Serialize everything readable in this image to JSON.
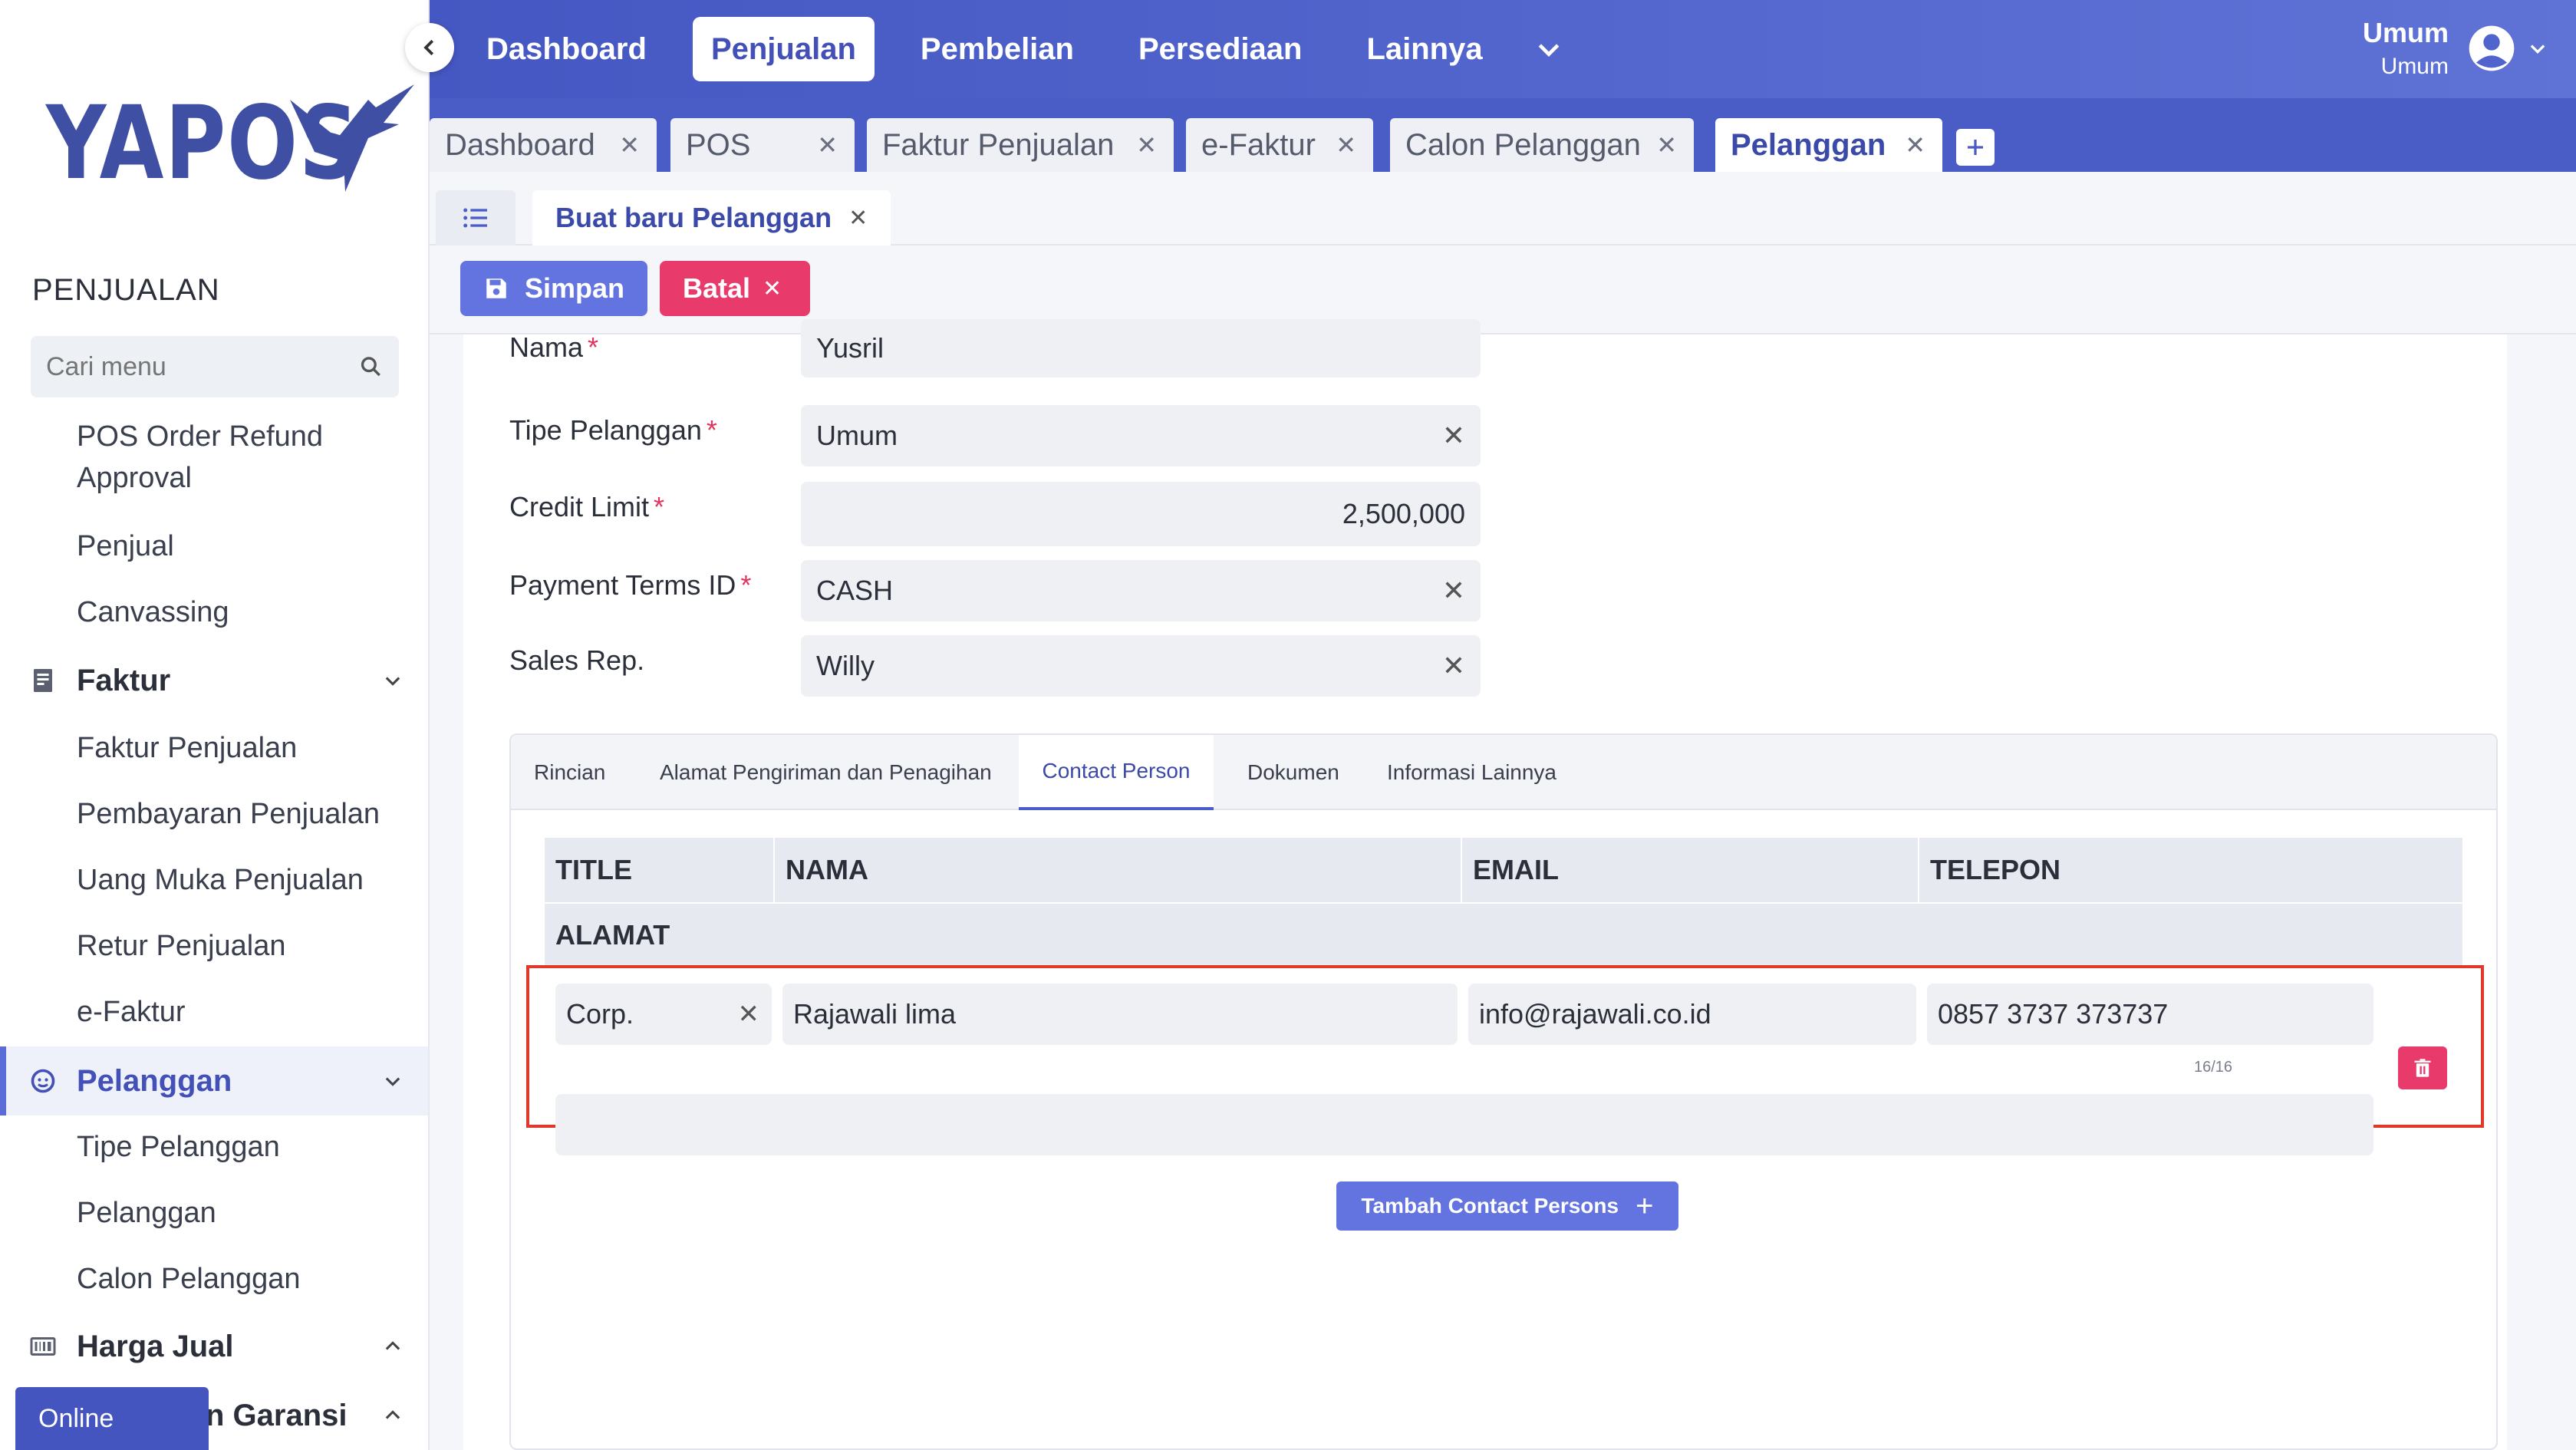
{
  "brand": {
    "logo_text": "YAPOS"
  },
  "sidebar": {
    "section_title": "PENJUALAN",
    "search_placeholder": "Cari menu",
    "items": [
      {
        "label": "POS Order Refund Approval",
        "type": "link"
      },
      {
        "label": "Penjual",
        "type": "link"
      },
      {
        "label": "Canvassing",
        "type": "link"
      }
    ],
    "group_faktur": {
      "label": "Faktur",
      "icon": "document-icon",
      "expanded": true
    },
    "faktur_items": [
      "Faktur Penjualan",
      "Pembayaran Penjualan",
      "Uang Muka Penjualan",
      "Retur Penjualan",
      "e-Faktur"
    ],
    "group_pelanggan": {
      "label": "Pelanggan",
      "icon": "smiley-icon",
      "expanded": true
    },
    "pelanggan_items": [
      "Tipe Pelanggan",
      "Pelanggan",
      "Calon Pelanggan"
    ],
    "group_harga": {
      "label": "Harga Jual",
      "icon": "barcode-icon",
      "expanded": false
    },
    "group_garansi": {
      "label": "n Garansi",
      "icon": "shield-icon",
      "expanded": false
    },
    "online_badge": "Online"
  },
  "topnav": {
    "items": [
      "Dashboard",
      "Penjualan",
      "Pembelian",
      "Persediaan",
      "Lainnya"
    ],
    "active": "Penjualan",
    "user_name": "Umum",
    "user_role": "Umum"
  },
  "tabs": {
    "items": [
      "Dashboard",
      "POS",
      "Faktur Penjualan",
      "e-Faktur",
      "Calon Pelanggan",
      "Pelanggan"
    ],
    "active": "Pelanggan"
  },
  "subtab": {
    "label": "Buat baru Pelanggan"
  },
  "actions": {
    "save": "Simpan",
    "cancel": "Batal"
  },
  "form": {
    "nama": {
      "label": "Nama",
      "value": "Yusril"
    },
    "tipe": {
      "label": "Tipe Pelanggan",
      "value": "Umum"
    },
    "credit": {
      "label": "Credit Limit",
      "value": "2,500,000"
    },
    "terms": {
      "label": "Payment Terms ID",
      "value": "CASH"
    },
    "sales": {
      "label": "Sales Rep.",
      "value": "Willy"
    }
  },
  "detail_tabs": {
    "items": [
      "Rincian",
      "Alamat Pengiriman dan Penagihan",
      "Contact Person",
      "Dokumen",
      "Informasi Lainnya"
    ],
    "active": "Contact Person"
  },
  "contact_table": {
    "headers": [
      "TITLE",
      "NAMA",
      "EMAIL",
      "TELEPON"
    ],
    "address_header": "ALAMAT",
    "row": {
      "title": "Corp.",
      "nama": "Rajawali lima",
      "email": "info@rajawali.co.id",
      "telepon": "0857 3737 373737",
      "counter": "16/16",
      "alamat": ""
    },
    "add_button": "Tambah Contact Persons"
  },
  "colors": {
    "primary": "#4a5cc6",
    "danger": "#e83a6b",
    "highlight_border": "#e0392b"
  }
}
